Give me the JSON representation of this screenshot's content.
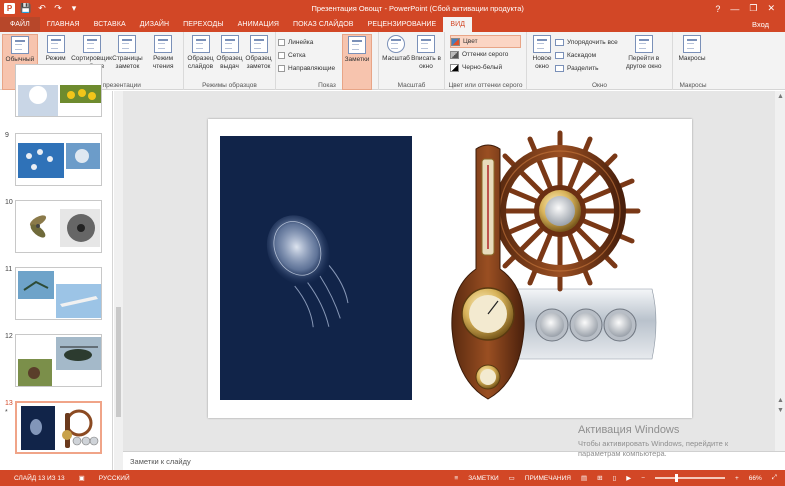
{
  "window": {
    "title": "Презентация Овощт - PowerPoint (Сбой активации продукта)",
    "help": "?",
    "minimize": "—",
    "restore": "❐",
    "close": "✕"
  },
  "qat": {
    "logo": "P",
    "save": "💾",
    "undo": "↶",
    "redo": "↷",
    "more": "▾"
  },
  "tabs": [
    "ФАЙЛ",
    "ГЛАВНАЯ",
    "ВСТАВКА",
    "ДИЗАЙН",
    "ПЕРЕХОДЫ",
    "АНИМАЦИЯ",
    "ПОКАЗ СЛАЙДОВ",
    "РЕЦЕНЗИРОВАНИЕ",
    "ВИД"
  ],
  "active_tab": "ВИД",
  "login": "Вход",
  "ribbon": {
    "presentation_views": {
      "name": "Режимы просмотра презентации",
      "buttons": [
        "Обычный",
        "Режим структуры",
        "Сортировщик слайдов",
        "Страницы заметок",
        "Режим чтения"
      ]
    },
    "master_views": {
      "name": "Режимы образцов",
      "buttons": [
        "Образец слайдов",
        "Образец выдач",
        "Образец заметок"
      ]
    },
    "show": {
      "name": "Показ",
      "checks": [
        "Линейка",
        "Сетка",
        "Направляющие"
      ],
      "notes": "Заметки"
    },
    "zoom": {
      "name": "Масштаб",
      "buttons": [
        "Масштаб",
        "Вписать в окно"
      ]
    },
    "color": {
      "name": "Цвет или оттенки серого",
      "items": [
        "Цвет",
        "Оттенки серого",
        "Черно-белый"
      ]
    },
    "window": {
      "name": "Окно",
      "new": "Новое окно",
      "items": [
        "Упорядочить все",
        "Каскадом",
        "Разделить"
      ],
      "switch": "Перейти в другое окно"
    },
    "macros": {
      "name": "Макросы",
      "button": "Макросы"
    }
  },
  "slides": [
    {
      "num": "",
      "star": ""
    },
    {
      "num": "9",
      "star": ""
    },
    {
      "num": "10",
      "star": ""
    },
    {
      "num": "11",
      "star": ""
    },
    {
      "num": "12",
      "star": ""
    },
    {
      "num": "13",
      "star": "*"
    }
  ],
  "notes_placeholder": "Заметки к слайду",
  "watermark": {
    "title": "Активация Windows",
    "line1": "Чтобы активировать Windows, перейдите к",
    "line2": "параметрам компьютера."
  },
  "status": {
    "slide": "СЛАЙД 13 ИЗ 13",
    "lang": "РУССКИЙ",
    "notes": "ЗАМЕТКИ",
    "comments": "ПРИМЕЧАНИЯ",
    "zoom_percent": "66%",
    "zoom_level": 0.66
  },
  "colors": {
    "accent": "#d24726",
    "ribbon_bg": "#f3f3f3",
    "slide_dark": "#112449"
  }
}
